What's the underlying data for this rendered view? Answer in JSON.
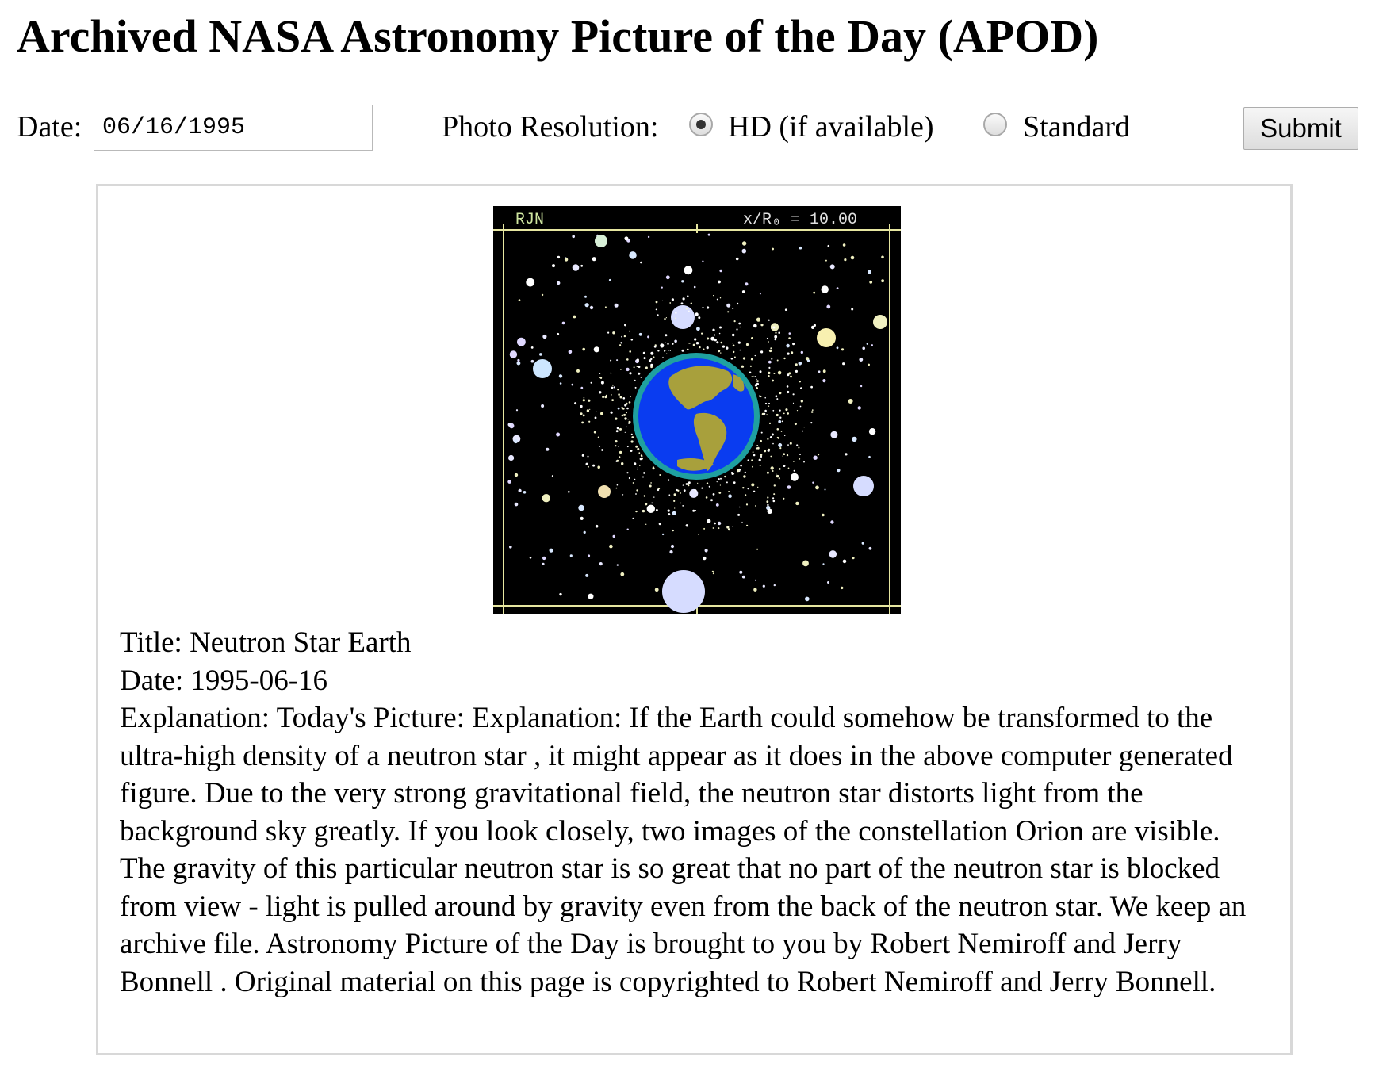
{
  "page": {
    "title": "Archived NASA Astronomy Picture of the Day (APOD)"
  },
  "form": {
    "date_label": "Date:",
    "date_value": "06/16/1995",
    "resolution_label": "Photo Resolution:",
    "options": [
      {
        "label": "HD (if available)",
        "selected": true
      },
      {
        "label": "Standard",
        "selected": false
      }
    ],
    "submit_label": "Submit"
  },
  "apod": {
    "image": {
      "icon": "neutron-star-earth-image",
      "top_left_text": "RJN",
      "top_right_text": "x/R₀ = 10.00",
      "colors": {
        "sky": "#000000",
        "ocean": "#0a3cf0",
        "land": "#a8a03c",
        "rim": "#1fa0a0",
        "frame": "#e6e6a0"
      }
    },
    "title_line": "Title: Neutron Star Earth",
    "date_line": "Date: 1995-06-16",
    "explanation_line": "Explanation: Today's Picture: Explanation: If the Earth could somehow be transformed to the ultra-high density of a neutron star , it might appear as it does in the above computer generated figure. Due to the very strong gravitational field, the neutron star distorts light from the background sky greatly. If you look closely, two images of the constellation Orion are visible. The gravity of this particular neutron star is so great that no part of the neutron star is blocked from view - light is pulled around by gravity even from the back of the neutron star. We keep an archive file. Astronomy Picture of the Day is brought to you by Robert Nemiroff and Jerry Bonnell . Original material on this page is copyrighted to Robert Nemiroff and Jerry Bonnell."
  }
}
